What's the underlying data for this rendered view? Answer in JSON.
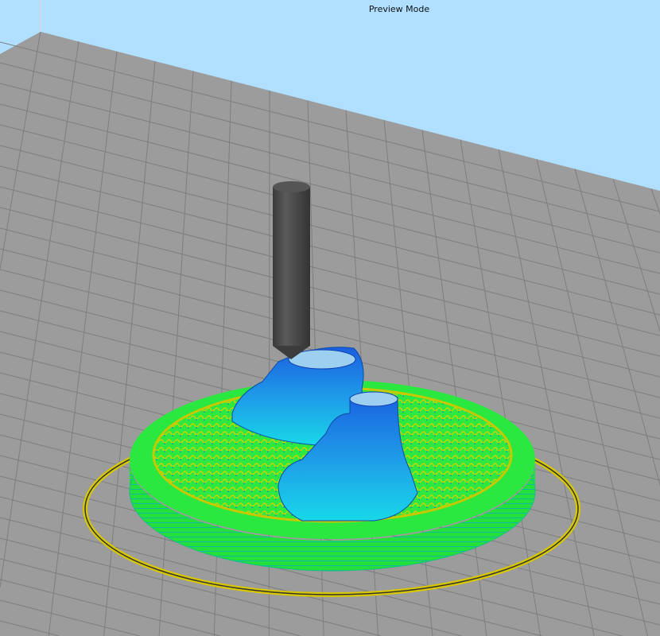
{
  "viewport": {
    "mode_label": "Preview Mode",
    "colors": {
      "background": "#b0dfff",
      "bed": "#9c9c9c",
      "grid": "#7e7e7e",
      "nozzle": "#4a4a4a",
      "skirt": "#e8e000",
      "infill_green": "#22e83a",
      "model_blue": "#1e90e8",
      "model_cyan": "#16d6e6"
    },
    "icons": [
      "nozzle-icon"
    ]
  }
}
